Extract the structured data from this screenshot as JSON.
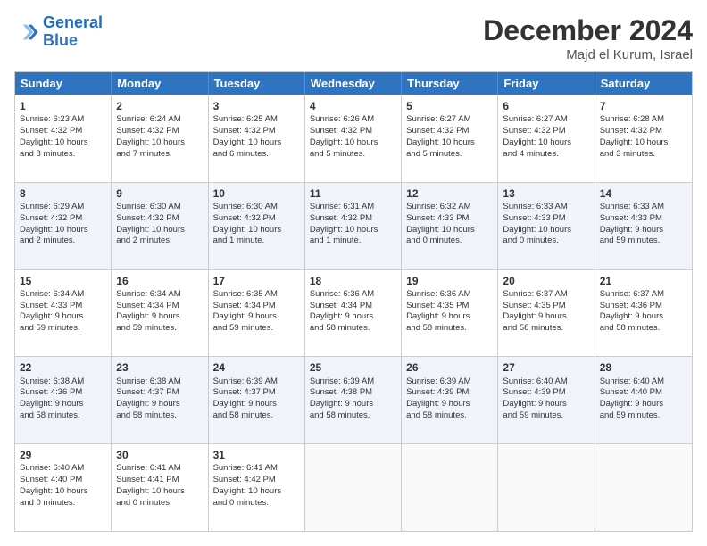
{
  "header": {
    "logo_line1": "General",
    "logo_line2": "Blue",
    "month_title": "December 2024",
    "location": "Majd el Kurum, Israel"
  },
  "weekdays": [
    "Sunday",
    "Monday",
    "Tuesday",
    "Wednesday",
    "Thursday",
    "Friday",
    "Saturday"
  ],
  "rows": [
    [
      {
        "day": "1",
        "lines": [
          "Sunrise: 6:23 AM",
          "Sunset: 4:32 PM",
          "Daylight: 10 hours",
          "and 8 minutes."
        ]
      },
      {
        "day": "2",
        "lines": [
          "Sunrise: 6:24 AM",
          "Sunset: 4:32 PM",
          "Daylight: 10 hours",
          "and 7 minutes."
        ]
      },
      {
        "day": "3",
        "lines": [
          "Sunrise: 6:25 AM",
          "Sunset: 4:32 PM",
          "Daylight: 10 hours",
          "and 6 minutes."
        ]
      },
      {
        "day": "4",
        "lines": [
          "Sunrise: 6:26 AM",
          "Sunset: 4:32 PM",
          "Daylight: 10 hours",
          "and 5 minutes."
        ]
      },
      {
        "day": "5",
        "lines": [
          "Sunrise: 6:27 AM",
          "Sunset: 4:32 PM",
          "Daylight: 10 hours",
          "and 5 minutes."
        ]
      },
      {
        "day": "6",
        "lines": [
          "Sunrise: 6:27 AM",
          "Sunset: 4:32 PM",
          "Daylight: 10 hours",
          "and 4 minutes."
        ]
      },
      {
        "day": "7",
        "lines": [
          "Sunrise: 6:28 AM",
          "Sunset: 4:32 PM",
          "Daylight: 10 hours",
          "and 3 minutes."
        ]
      }
    ],
    [
      {
        "day": "8",
        "lines": [
          "Sunrise: 6:29 AM",
          "Sunset: 4:32 PM",
          "Daylight: 10 hours",
          "and 2 minutes."
        ]
      },
      {
        "day": "9",
        "lines": [
          "Sunrise: 6:30 AM",
          "Sunset: 4:32 PM",
          "Daylight: 10 hours",
          "and 2 minutes."
        ]
      },
      {
        "day": "10",
        "lines": [
          "Sunrise: 6:30 AM",
          "Sunset: 4:32 PM",
          "Daylight: 10 hours",
          "and 1 minute."
        ]
      },
      {
        "day": "11",
        "lines": [
          "Sunrise: 6:31 AM",
          "Sunset: 4:32 PM",
          "Daylight: 10 hours",
          "and 1 minute."
        ]
      },
      {
        "day": "12",
        "lines": [
          "Sunrise: 6:32 AM",
          "Sunset: 4:33 PM",
          "Daylight: 10 hours",
          "and 0 minutes."
        ]
      },
      {
        "day": "13",
        "lines": [
          "Sunrise: 6:33 AM",
          "Sunset: 4:33 PM",
          "Daylight: 10 hours",
          "and 0 minutes."
        ]
      },
      {
        "day": "14",
        "lines": [
          "Sunrise: 6:33 AM",
          "Sunset: 4:33 PM",
          "Daylight: 9 hours",
          "and 59 minutes."
        ]
      }
    ],
    [
      {
        "day": "15",
        "lines": [
          "Sunrise: 6:34 AM",
          "Sunset: 4:33 PM",
          "Daylight: 9 hours",
          "and 59 minutes."
        ]
      },
      {
        "day": "16",
        "lines": [
          "Sunrise: 6:34 AM",
          "Sunset: 4:34 PM",
          "Daylight: 9 hours",
          "and 59 minutes."
        ]
      },
      {
        "day": "17",
        "lines": [
          "Sunrise: 6:35 AM",
          "Sunset: 4:34 PM",
          "Daylight: 9 hours",
          "and 59 minutes."
        ]
      },
      {
        "day": "18",
        "lines": [
          "Sunrise: 6:36 AM",
          "Sunset: 4:34 PM",
          "Daylight: 9 hours",
          "and 58 minutes."
        ]
      },
      {
        "day": "19",
        "lines": [
          "Sunrise: 6:36 AM",
          "Sunset: 4:35 PM",
          "Daylight: 9 hours",
          "and 58 minutes."
        ]
      },
      {
        "day": "20",
        "lines": [
          "Sunrise: 6:37 AM",
          "Sunset: 4:35 PM",
          "Daylight: 9 hours",
          "and 58 minutes."
        ]
      },
      {
        "day": "21",
        "lines": [
          "Sunrise: 6:37 AM",
          "Sunset: 4:36 PM",
          "Daylight: 9 hours",
          "and 58 minutes."
        ]
      }
    ],
    [
      {
        "day": "22",
        "lines": [
          "Sunrise: 6:38 AM",
          "Sunset: 4:36 PM",
          "Daylight: 9 hours",
          "and 58 minutes."
        ]
      },
      {
        "day": "23",
        "lines": [
          "Sunrise: 6:38 AM",
          "Sunset: 4:37 PM",
          "Daylight: 9 hours",
          "and 58 minutes."
        ]
      },
      {
        "day": "24",
        "lines": [
          "Sunrise: 6:39 AM",
          "Sunset: 4:37 PM",
          "Daylight: 9 hours",
          "and 58 minutes."
        ]
      },
      {
        "day": "25",
        "lines": [
          "Sunrise: 6:39 AM",
          "Sunset: 4:38 PM",
          "Daylight: 9 hours",
          "and 58 minutes."
        ]
      },
      {
        "day": "26",
        "lines": [
          "Sunrise: 6:39 AM",
          "Sunset: 4:39 PM",
          "Daylight: 9 hours",
          "and 58 minutes."
        ]
      },
      {
        "day": "27",
        "lines": [
          "Sunrise: 6:40 AM",
          "Sunset: 4:39 PM",
          "Daylight: 9 hours",
          "and 59 minutes."
        ]
      },
      {
        "day": "28",
        "lines": [
          "Sunrise: 6:40 AM",
          "Sunset: 4:40 PM",
          "Daylight: 9 hours",
          "and 59 minutes."
        ]
      }
    ],
    [
      {
        "day": "29",
        "lines": [
          "Sunrise: 6:40 AM",
          "Sunset: 4:40 PM",
          "Daylight: 10 hours",
          "and 0 minutes."
        ]
      },
      {
        "day": "30",
        "lines": [
          "Sunrise: 6:41 AM",
          "Sunset: 4:41 PM",
          "Daylight: 10 hours",
          "and 0 minutes."
        ]
      },
      {
        "day": "31",
        "lines": [
          "Sunrise: 6:41 AM",
          "Sunset: 4:42 PM",
          "Daylight: 10 hours",
          "and 0 minutes."
        ]
      },
      null,
      null,
      null,
      null
    ]
  ]
}
